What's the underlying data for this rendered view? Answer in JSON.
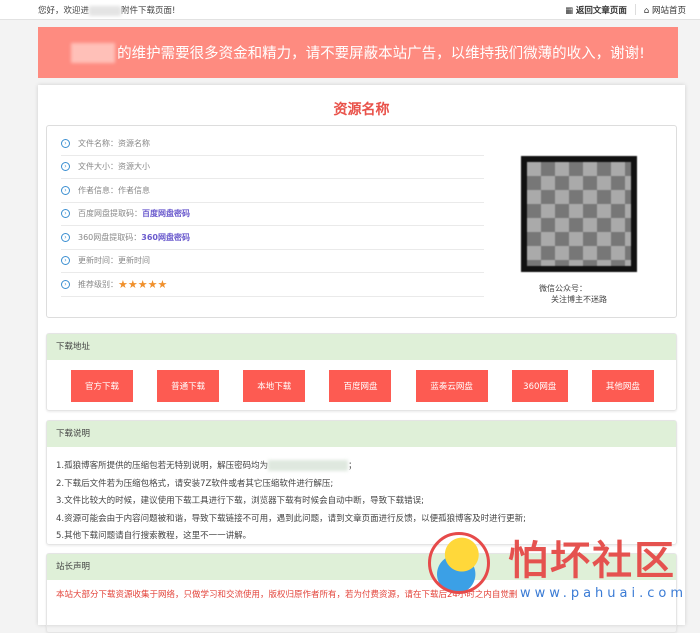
{
  "topbar": {
    "welcome_prefix": "您好，欢迎进",
    "welcome_suffix": "附件下载页面!",
    "back_link": "返回文章页面",
    "home_link": "网站首页"
  },
  "banner": {
    "text": "的维护需要很多资金和精力，请不要屏蔽本站广告，以维持我们微薄的收入，谢谢!"
  },
  "title": "资源名称",
  "info": [
    {
      "label": "文件名称：",
      "value": "资源名称"
    },
    {
      "label": "文件大小：",
      "value": "资源大小"
    },
    {
      "label": "作者信息：",
      "value": "作者信息"
    },
    {
      "label": "百度网盘提取码：",
      "value": "百度网盘密码",
      "link": true
    },
    {
      "label": "360网盘提取码：",
      "value": "360网盘密码",
      "link": true
    },
    {
      "label": "更新时间：",
      "value": "更新时间"
    },
    {
      "label": "推荐级别：",
      "value": "★★★★★",
      "rating": 5
    }
  ],
  "qr": {
    "line1": "微信公众号：",
    "line2": "关注博主不迷路"
  },
  "download": {
    "heading": "下载地址",
    "buttons": [
      "官方下载",
      "普通下载",
      "本地下载",
      "百度网盘",
      "蓝奏云网盘",
      "360网盘",
      "其他网盘"
    ]
  },
  "notes": {
    "heading": "下载说明",
    "items": [
      "1.孤狼博客所提供的压缩包若无特别说明，解压密码均为",
      "2.下载后文件若为压缩包格式，请安装7Z软件或者其它压缩软件进行解压;",
      "3.文件比较大的时候，建议使用下载工具进行下载，浏览器下载有时候会自动中断，导致下载错误;",
      "4.资源可能会由于内容问题被和谐，导致下载链接不可用，遇到此问题，请到文章页面进行反馈，以便孤狼博客及时进行更新;",
      "5.其他下载问题请自行搜索教程，这里不一一讲解。"
    ],
    "item1_end": "；"
  },
  "declaration": {
    "heading": "站长声明",
    "text": "本站大部分下载资源收集于网络，只做学习和交流使用，版权归原作者所有，若为付费资源，请在下载后24小时之内自觉删"
  },
  "watermark": {
    "name": "怕坏社区",
    "url": "www.pahuai.com"
  },
  "colors": {
    "banner": "#fe8b80",
    "button": "#fd5b52",
    "section_header": "#dff0d8",
    "title": "#e9524a",
    "star": "#f0902c"
  }
}
